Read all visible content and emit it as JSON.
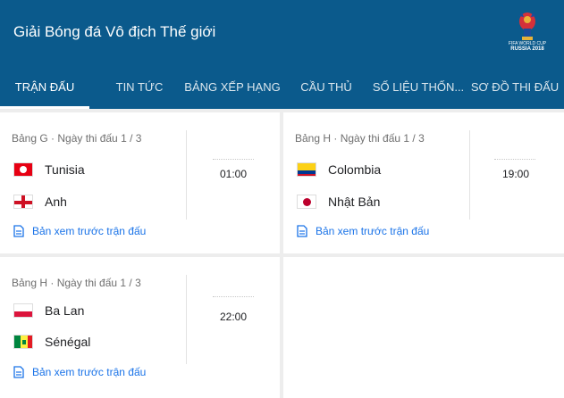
{
  "header": {
    "title": "Giải Bóng đá Vô địch Thế giới",
    "logo_text_1": "FIFA WORLD CUP",
    "logo_text_2": "RUSSIA 2018"
  },
  "tabs": [
    {
      "label": "TRẬN ĐẤU",
      "active": true
    },
    {
      "label": "TIN TỨC",
      "active": false
    },
    {
      "label": "BẢNG XẾP HẠNG",
      "active": false
    },
    {
      "label": "CẦU THỦ",
      "active": false
    },
    {
      "label": "SỐ LIỆU THỐN...",
      "active": false
    },
    {
      "label": "SƠ ĐỒ THI ĐẤU",
      "active": false
    }
  ],
  "matches": [
    {
      "meta": "Bảng G · Ngày thi đấu 1 / 3",
      "home": {
        "name": "Tunisia",
        "flag": "tunisia-flag"
      },
      "away": {
        "name": "Anh",
        "flag": "england-flag"
      },
      "time": "01:00",
      "preview": "Bản xem trước trận đấu"
    },
    {
      "meta": "Bảng H · Ngày thi đấu 1 / 3",
      "home": {
        "name": "Colombia",
        "flag": "colombia-flag"
      },
      "away": {
        "name": "Nhật Bản",
        "flag": "japan-flag"
      },
      "time": "19:00",
      "preview": "Bản xem trước trận đấu"
    },
    {
      "meta": "Bảng H · Ngày thi đấu 1 / 3",
      "home": {
        "name": "Ba Lan",
        "flag": "poland-flag"
      },
      "away": {
        "name": "Sénégal",
        "flag": "senegal-flag"
      },
      "time": "22:00",
      "preview": "Bản xem trước trận đấu"
    }
  ],
  "colors": {
    "header": "#0b5a8c",
    "link": "#1a73e8"
  }
}
